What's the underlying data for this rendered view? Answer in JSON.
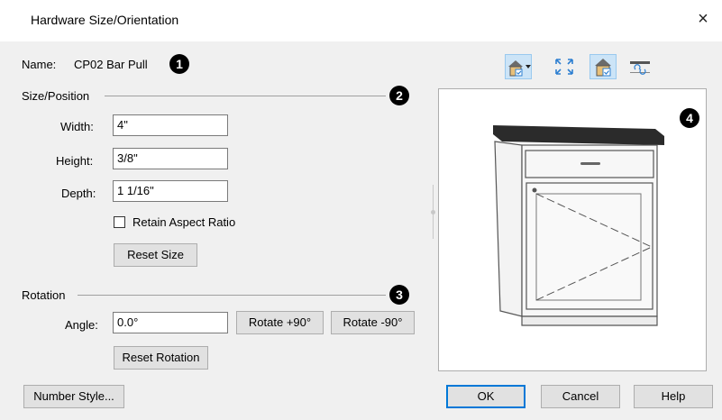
{
  "dialog": {
    "title": "Hardware Size/Orientation",
    "close_glyph": "×"
  },
  "name": {
    "label": "Name:",
    "value": "CP02 Bar Pull",
    "badge": "1"
  },
  "size_position": {
    "heading": "Size/Position",
    "badge": "2",
    "width_label": "Width:",
    "width_value": "4\"",
    "height_label": "Height:",
    "height_value": "3/8\"",
    "depth_label": "Depth:",
    "depth_value": "1 1/16\"",
    "retain_aspect_label": "Retain Aspect Ratio",
    "retain_aspect_checked": false,
    "reset_size_label": "Reset Size"
  },
  "rotation": {
    "heading": "Rotation",
    "badge": "3",
    "angle_label": "Angle:",
    "angle_value": "0.0°",
    "rotate_plus_label": "Rotate +90°",
    "rotate_minus_label": "Rotate -90°",
    "reset_rotation_label": "Reset Rotation"
  },
  "preview": {
    "badge": "4",
    "toolbar": [
      "camera-view-dropdown-icon",
      "fill-window-icon",
      "show-colors-icon",
      "rotate-view-icon"
    ]
  },
  "footer": {
    "number_style_label": "Number Style...",
    "ok_label": "OK",
    "cancel_label": "Cancel",
    "help_label": "Help"
  },
  "colors": {
    "dialog_bg": "#f0f0f0",
    "accent": "#0078d7",
    "countertop": "#222222",
    "cabinet_outline": "#555555"
  }
}
